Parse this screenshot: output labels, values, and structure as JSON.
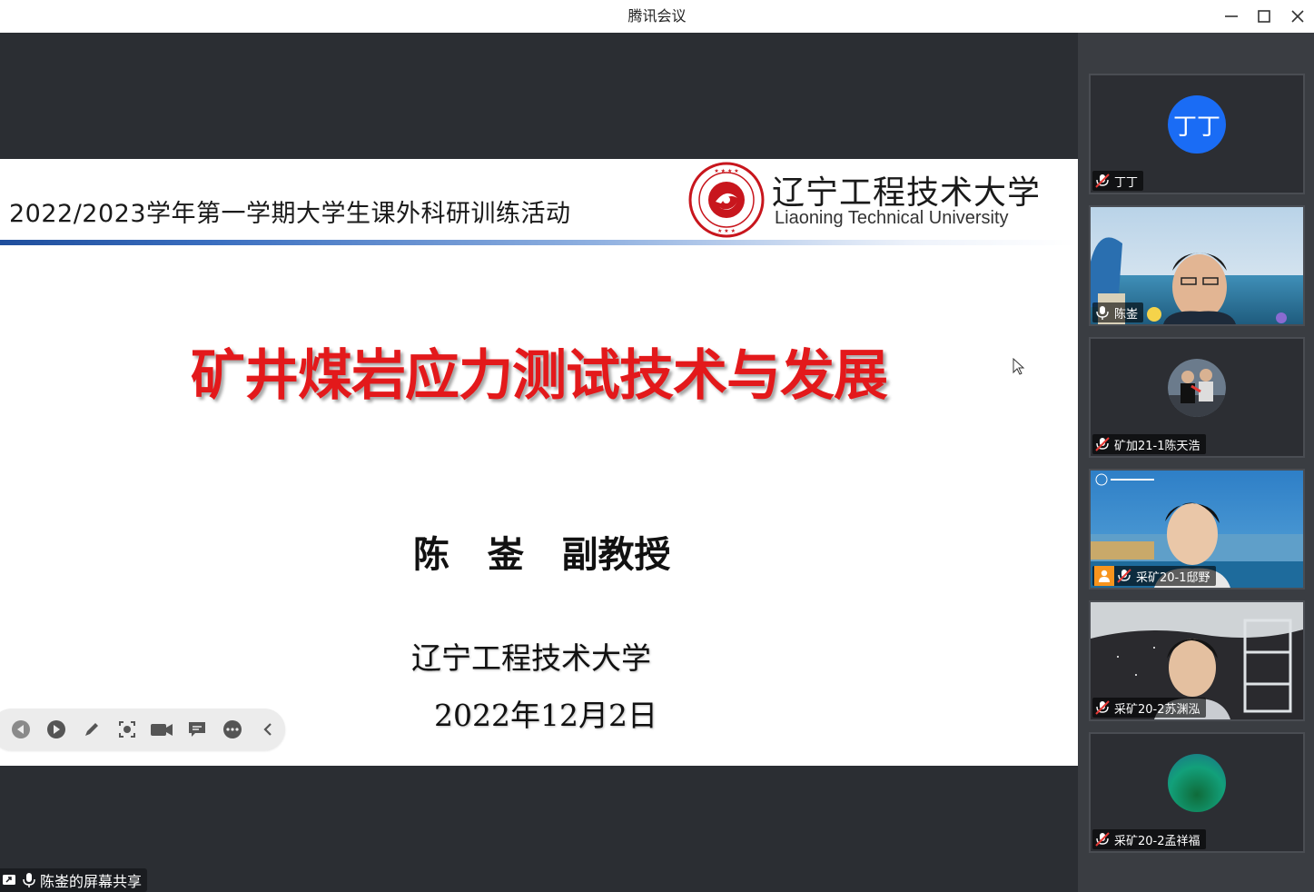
{
  "window": {
    "title": "腾讯会议"
  },
  "slide": {
    "header_text": "2022/2023学年第一学期大学生课外科研训练活动",
    "university_cn": "辽宁工程技术大学",
    "university_en": "Liaoning Technical University",
    "title": "矿井煤岩应力测试技术与发展",
    "presenter": "陈   崟   副教授",
    "organization": "辽宁工程技术大学",
    "date": "2022年12月2日"
  },
  "share_label": "陈崟的屏幕共享",
  "participants": [
    {
      "name": "丁丁",
      "initials": "丁丁",
      "muted": true,
      "type": "avatar",
      "color": "#1a6cf5"
    },
    {
      "name": "陈崟",
      "muted": false,
      "type": "video"
    },
    {
      "name": "矿加21-1陈天浩",
      "muted": true,
      "type": "photo"
    },
    {
      "name": "采矿20-1邸野",
      "muted": true,
      "type": "video",
      "host_badge": true
    },
    {
      "name": "采矿20-2苏渊泓",
      "muted": true,
      "type": "video"
    },
    {
      "name": "采矿20-2孟祥福",
      "muted": true,
      "type": "avatar",
      "color": "#1b8a5a"
    }
  ]
}
